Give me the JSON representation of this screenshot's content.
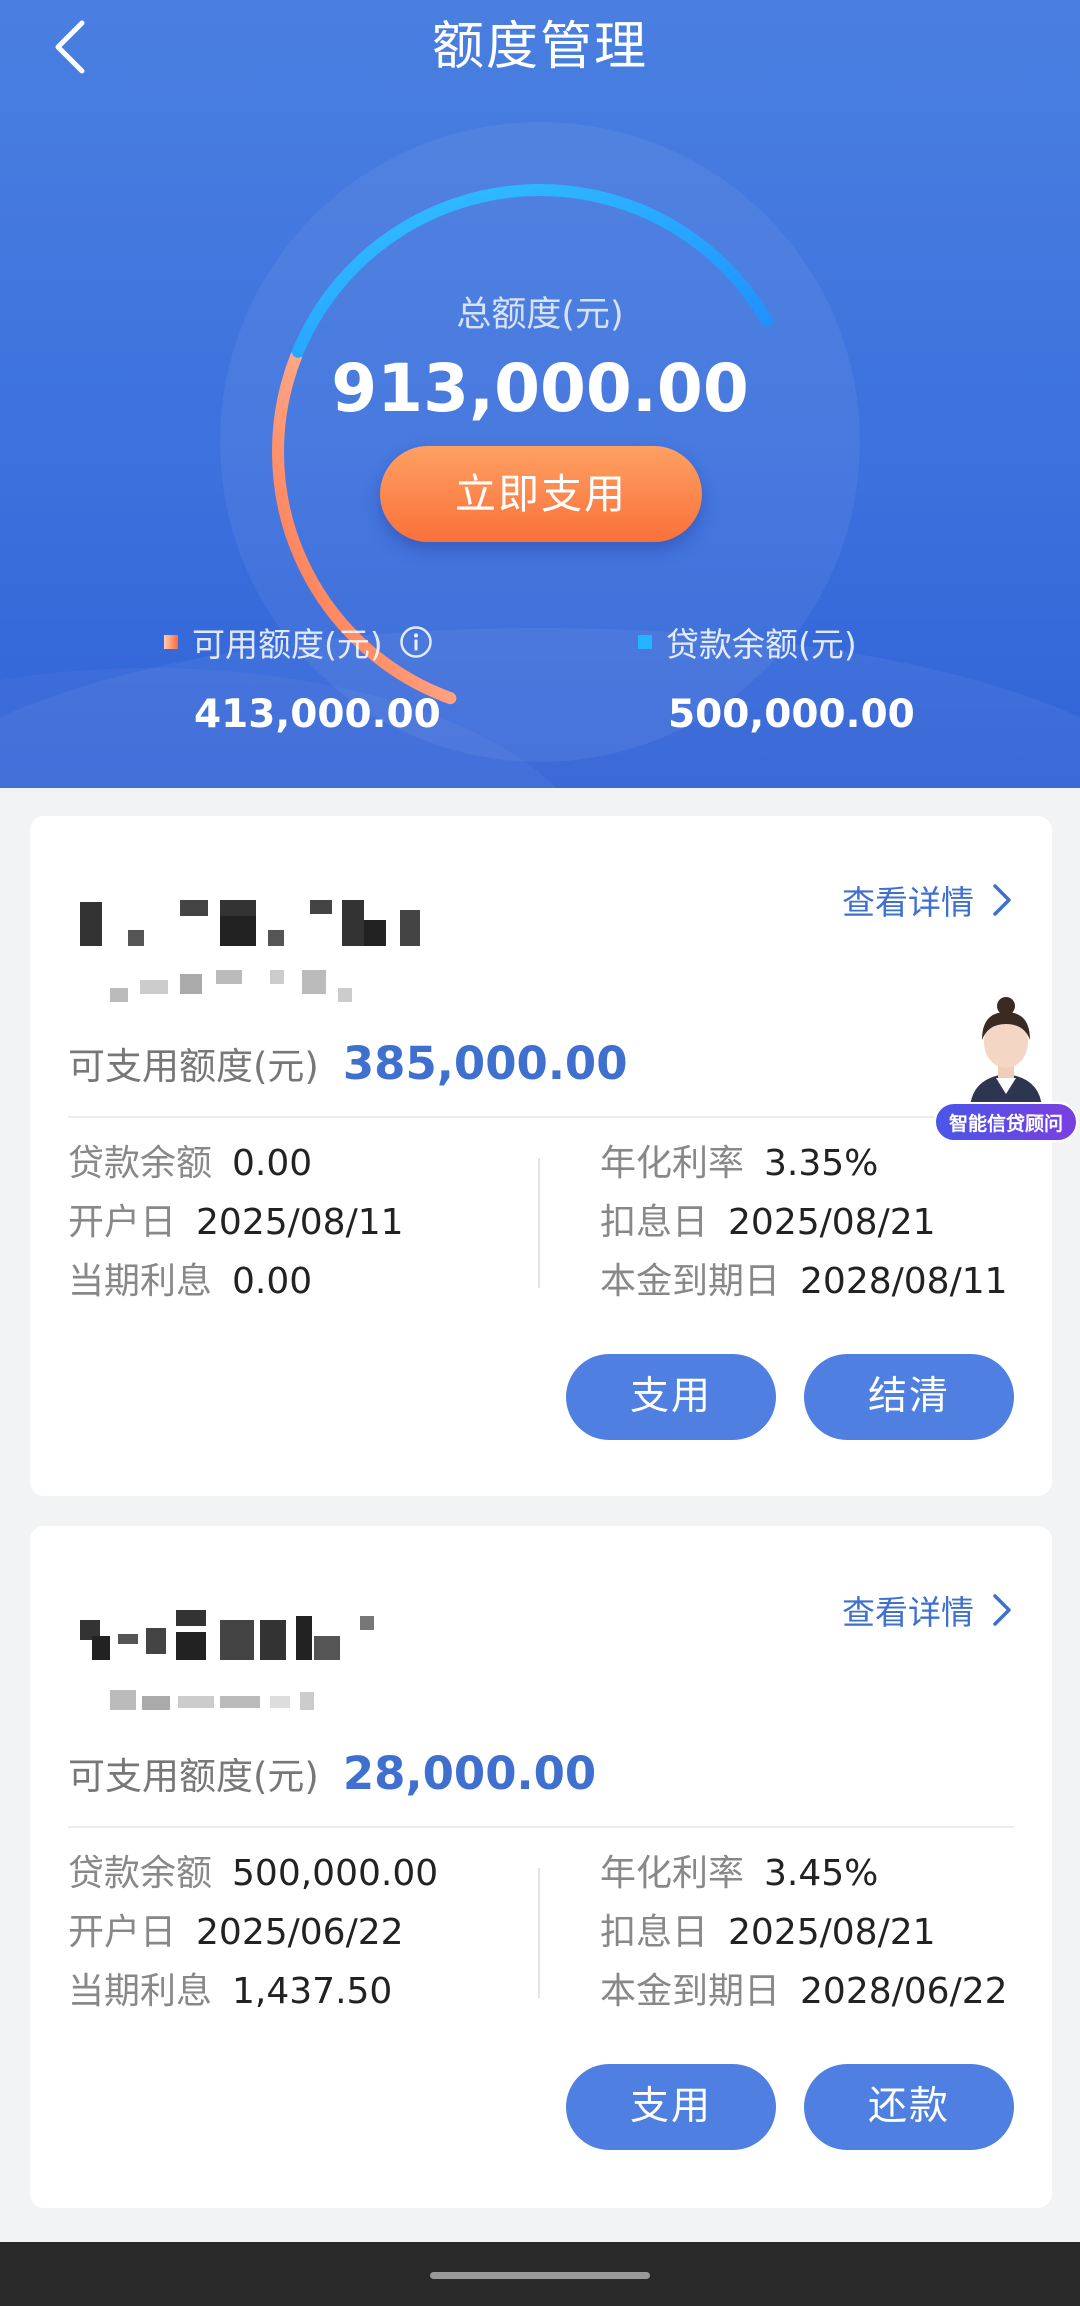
{
  "header": {
    "title": "额度管理",
    "back_icon": "chevron-left-icon"
  },
  "summary": {
    "total_label": "总额度(元)",
    "total_amount": "913,000.00",
    "use_now_label": "立即支用",
    "available_label": "可用额度(元)",
    "available_amount": "413,000.00",
    "loan_balance_label": "贷款余额(元)",
    "loan_balance_amount": "500,000.00",
    "gauge_used_fraction": 0.548,
    "colors": {
      "available": "#ff6a3d",
      "loan": "#24b4ff"
    }
  },
  "cards": [
    {
      "detail_link": "查看详情",
      "avail_label": "可支用额度(元)",
      "avail_value": "385,000.00",
      "left": [
        {
          "k": "贷款余额",
          "v": "0.00"
        },
        {
          "k": "开户日",
          "v": "2025/08/11"
        },
        {
          "k": "当期利息",
          "v": "0.00"
        }
      ],
      "right": [
        {
          "k": "年化利率",
          "v": "3.35%"
        },
        {
          "k": "扣息日",
          "v": "2025/08/21"
        },
        {
          "k": "本金到期日",
          "v": "2028/08/11"
        }
      ],
      "buttons": [
        "支用",
        "结清"
      ]
    },
    {
      "detail_link": "查看详情",
      "avail_label": "可支用额度(元)",
      "avail_value": "28,000.00",
      "left": [
        {
          "k": "贷款余额",
          "v": "500,000.00"
        },
        {
          "k": "开户日",
          "v": "2025/06/22"
        },
        {
          "k": "当期利息",
          "v": "1,437.50"
        }
      ],
      "right": [
        {
          "k": "年化利率",
          "v": "3.45%"
        },
        {
          "k": "扣息日",
          "v": "2025/08/21"
        },
        {
          "k": "本金到期日",
          "v": "2028/06/22"
        }
      ],
      "buttons": [
        "支用",
        "还款"
      ]
    }
  ],
  "advisor": {
    "label": "智能信贷顾问"
  }
}
